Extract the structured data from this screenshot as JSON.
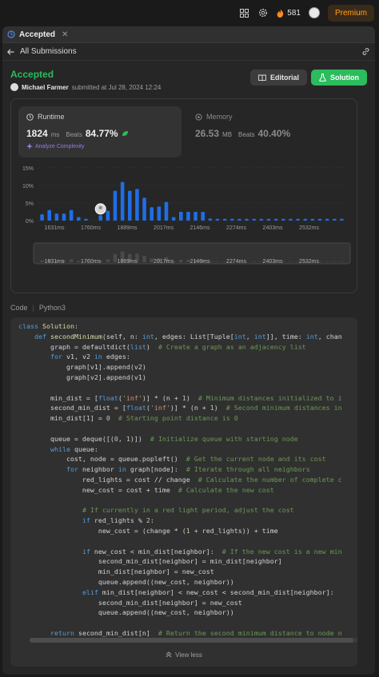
{
  "topbar": {
    "streak_count": "581",
    "premium_label": "Premium"
  },
  "tab": {
    "label": "Accepted",
    "close": "✕"
  },
  "subbar": {
    "back_label": "All Submissions"
  },
  "submission": {
    "status": "Accepted",
    "user": "Michael Farmer",
    "submitted_text": "submitted at Jul 28, 2024 12:24",
    "editorial_label": "Editorial",
    "solution_label": "Solution"
  },
  "runtime": {
    "title": "Runtime",
    "value": "1824",
    "unit": "ms",
    "beats_label": "Beats",
    "beats_pct": "84.77%",
    "analyze_label": "Analyze Complexity"
  },
  "memory": {
    "title": "Memory",
    "value": "26.53",
    "unit": "MB",
    "beats_label": "Beats",
    "beats_pct": "40.40%"
  },
  "chart_data": {
    "type": "bar",
    "yticks": [
      "15%",
      "10%",
      "5%",
      "0%"
    ],
    "ylim": [
      0,
      15
    ],
    "xticks": [
      "1631ms",
      "1760ms",
      "1889ms",
      "2017ms",
      "2146ms",
      "2274ms",
      "2403ms",
      "2532ms"
    ],
    "values": [
      1.8,
      3.0,
      2.0,
      2.0,
      3.0,
      1.0,
      0.5,
      0,
      1.5,
      2.8,
      8.5,
      11.0,
      8.5,
      9.0,
      6.5,
      3.8,
      4.0,
      5.3,
      1.0,
      2.5,
      2.5,
      2.5,
      2.5,
      0.6,
      0.5,
      0.5,
      0.5,
      0.5,
      0.5,
      0.5,
      0.5,
      0.5,
      0.5,
      0.5,
      0.5,
      0.5,
      0.5,
      0.5,
      0.5,
      0.5,
      0.5,
      0.5
    ],
    "highlight_index": 8,
    "bar_color": "#1e6ee6",
    "grid": true
  },
  "code": {
    "header_code": "Code",
    "header_lang": "Python3",
    "view_less": "View less"
  }
}
